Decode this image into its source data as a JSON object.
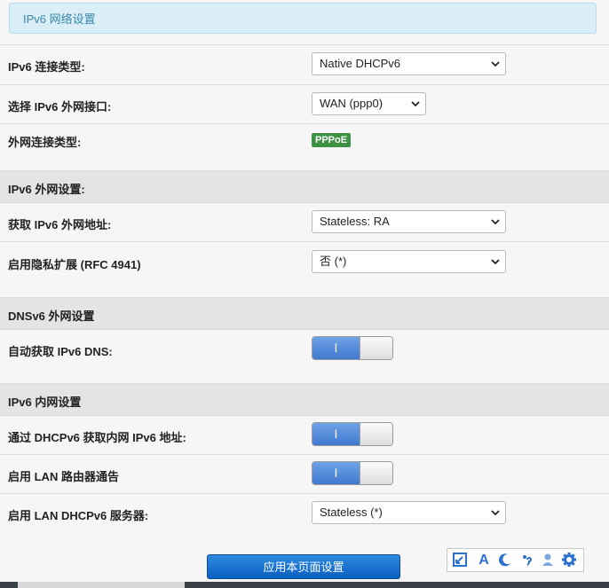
{
  "banner": {
    "title": "IPv6 网络设置"
  },
  "rows": {
    "conn_type": {
      "label": "IPv6 连接类型:",
      "value": "Native DHCPv6"
    },
    "wan_iface": {
      "label": "选择 IPv6 外网接口:",
      "value": "WAN (ppp0)"
    },
    "ext_type": {
      "label": "外网连接类型:",
      "badge": "PPPoE"
    },
    "get_addr": {
      "label": "获取 IPv6 外网地址:",
      "value": "Stateless: RA"
    },
    "privacy": {
      "label": "启用隐私扩展 (RFC 4941)",
      "value": "否 (*)"
    },
    "auto_dns": {
      "label": "自动获取 IPv6 DNS:",
      "toggle": "I"
    },
    "dhcpv6_lan_addr": {
      "label": "通过 DHCPv6 获取内网 IPv6 地址:",
      "toggle": "I"
    },
    "lan_ra": {
      "label": "启用 LAN 路由器通告",
      "toggle": "I"
    },
    "lan_dhcpv6_server": {
      "label": "启用 LAN DHCPv6 服务器:",
      "value": "Stateless (*)"
    }
  },
  "sections": {
    "wan": "IPv6 外网设置:",
    "dns": "DNSv6 外网设置",
    "lan": "IPv6 内网设置"
  },
  "apply_button": "应用本页面设置",
  "toolbar": {
    "icons": [
      "resize-icon",
      "font-icon",
      "moon-icon",
      "comma-icon",
      "user-icon",
      "gear-icon"
    ],
    "font_glyph": "A"
  },
  "colors": {
    "accent": "#2b6fd1",
    "badge": "#3d9142",
    "apply": "#1273d6",
    "banner": "#d9eef6"
  }
}
